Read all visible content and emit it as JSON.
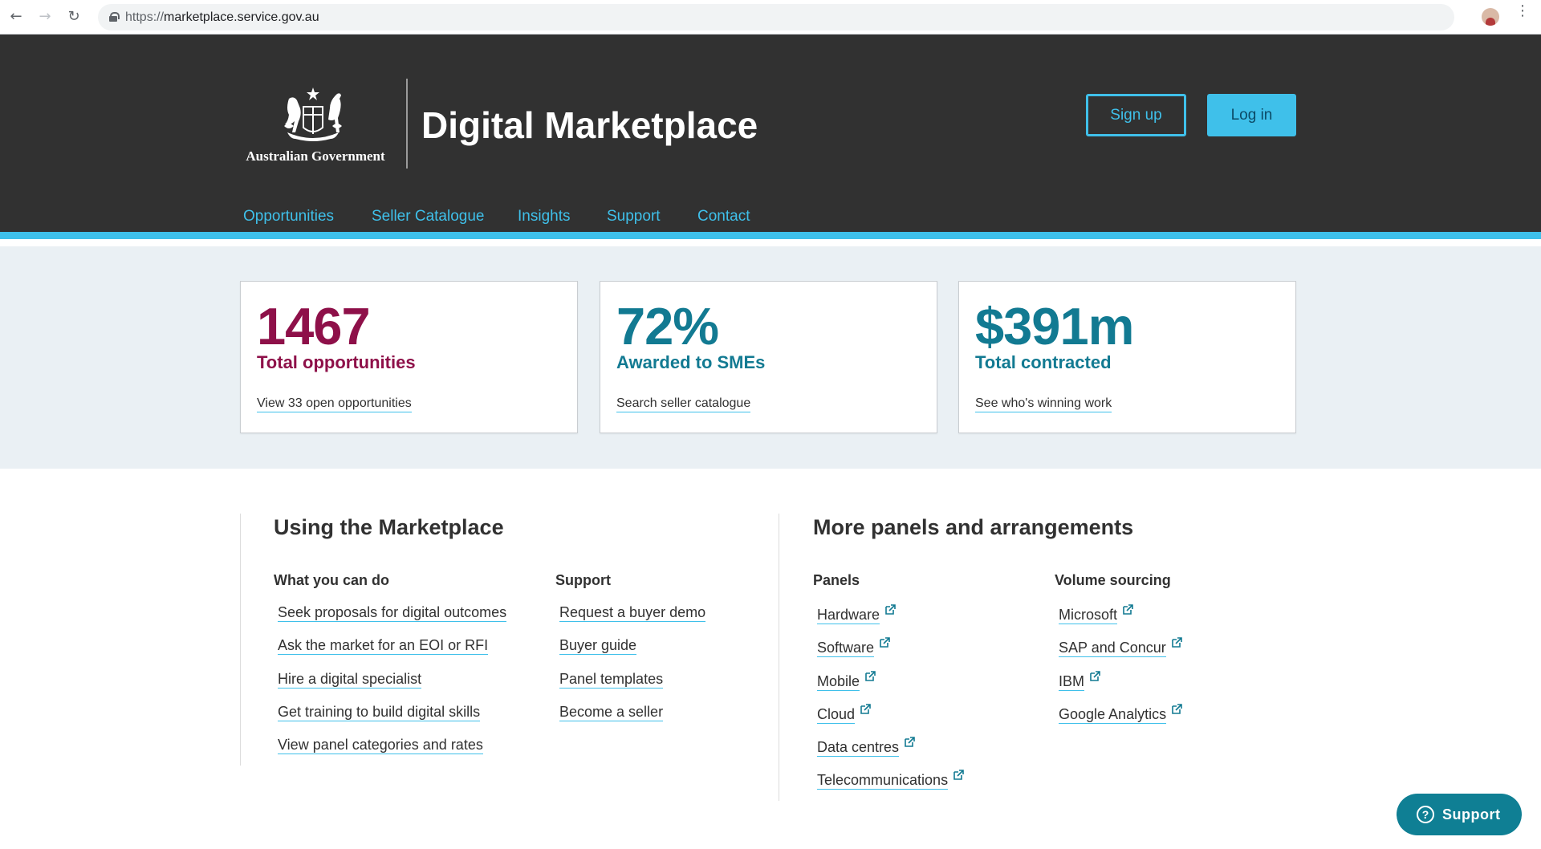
{
  "browser": {
    "url_scheme": "https://",
    "url_host": "marketplace.service.gov.au",
    "back_icon": "arrow-left",
    "forward_icon": "arrow-right",
    "reload_icon": "reload",
    "bookmark_icon": "star-outline",
    "menu_icon": "vertical-dots"
  },
  "header": {
    "gov_name": "Australian Government",
    "site_title": "Digital Marketplace",
    "signup_label": "Sign up",
    "login_label": "Log in",
    "nav": [
      "Opportunities",
      "Seller Catalogue",
      "Insights",
      "Support",
      "Contact"
    ]
  },
  "stats": [
    {
      "value": "1467",
      "label": "Total opportunities",
      "link": "View 33 open opportunities",
      "color": "#8e1049"
    },
    {
      "value": "72%",
      "label": "Awarded to SMEs",
      "link": "Search seller catalogue",
      "color": "#127a92"
    },
    {
      "value": "$391m",
      "label": "Total contracted",
      "link": "See who's winning work",
      "color": "#127a92"
    }
  ],
  "using": {
    "title": "Using the Marketplace",
    "col1": {
      "heading": "What you can do",
      "links": [
        "Seek proposals for digital outcomes",
        "Ask the market for an EOI or RFI",
        "Hire a digital specialist",
        "Get training to build digital skills",
        "View panel categories and rates"
      ]
    },
    "col2": {
      "heading": "Support",
      "links": [
        "Request a buyer demo",
        "Buyer guide",
        "Panel templates",
        "Become a seller"
      ]
    }
  },
  "panels": {
    "title": "More panels and arrangements",
    "col1": {
      "heading": "Panels",
      "links": [
        "Hardware",
        "Software",
        "Mobile",
        "Cloud",
        "Data centres",
        "Telecommunications"
      ]
    },
    "col2": {
      "heading": "Volume sourcing",
      "links": [
        "Microsoft",
        "SAP and Concur",
        "IBM",
        "Google Analytics"
      ]
    }
  },
  "support_widget": {
    "label": "Support",
    "icon": "question-circle"
  },
  "colors": {
    "accent": "#3fc0ea",
    "header_bg": "#313131",
    "red": "#8e1049",
    "teal": "#127a92"
  }
}
